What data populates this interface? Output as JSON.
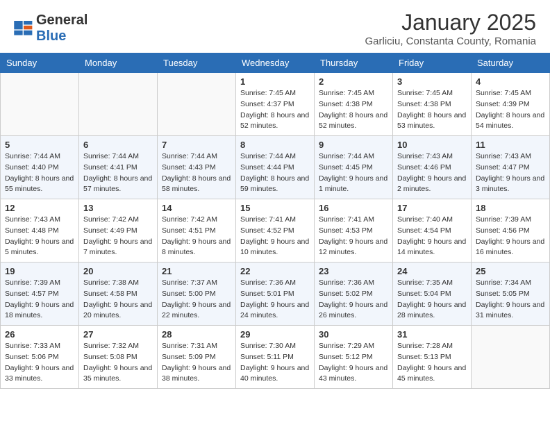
{
  "header": {
    "logo_general": "General",
    "logo_blue": "Blue",
    "month": "January 2025",
    "location": "Garliciu, Constanta County, Romania"
  },
  "days_of_week": [
    "Sunday",
    "Monday",
    "Tuesday",
    "Wednesday",
    "Thursday",
    "Friday",
    "Saturday"
  ],
  "weeks": [
    [
      {
        "day": "",
        "info": ""
      },
      {
        "day": "",
        "info": ""
      },
      {
        "day": "",
        "info": ""
      },
      {
        "day": "1",
        "info": "Sunrise: 7:45 AM\nSunset: 4:37 PM\nDaylight: 8 hours and 52 minutes."
      },
      {
        "day": "2",
        "info": "Sunrise: 7:45 AM\nSunset: 4:38 PM\nDaylight: 8 hours and 52 minutes."
      },
      {
        "day": "3",
        "info": "Sunrise: 7:45 AM\nSunset: 4:38 PM\nDaylight: 8 hours and 53 minutes."
      },
      {
        "day": "4",
        "info": "Sunrise: 7:45 AM\nSunset: 4:39 PM\nDaylight: 8 hours and 54 minutes."
      }
    ],
    [
      {
        "day": "5",
        "info": "Sunrise: 7:44 AM\nSunset: 4:40 PM\nDaylight: 8 hours and 55 minutes."
      },
      {
        "day": "6",
        "info": "Sunrise: 7:44 AM\nSunset: 4:41 PM\nDaylight: 8 hours and 57 minutes."
      },
      {
        "day": "7",
        "info": "Sunrise: 7:44 AM\nSunset: 4:43 PM\nDaylight: 8 hours and 58 minutes."
      },
      {
        "day": "8",
        "info": "Sunrise: 7:44 AM\nSunset: 4:44 PM\nDaylight: 8 hours and 59 minutes."
      },
      {
        "day": "9",
        "info": "Sunrise: 7:44 AM\nSunset: 4:45 PM\nDaylight: 9 hours and 1 minute."
      },
      {
        "day": "10",
        "info": "Sunrise: 7:43 AM\nSunset: 4:46 PM\nDaylight: 9 hours and 2 minutes."
      },
      {
        "day": "11",
        "info": "Sunrise: 7:43 AM\nSunset: 4:47 PM\nDaylight: 9 hours and 3 minutes."
      }
    ],
    [
      {
        "day": "12",
        "info": "Sunrise: 7:43 AM\nSunset: 4:48 PM\nDaylight: 9 hours and 5 minutes."
      },
      {
        "day": "13",
        "info": "Sunrise: 7:42 AM\nSunset: 4:49 PM\nDaylight: 9 hours and 7 minutes."
      },
      {
        "day": "14",
        "info": "Sunrise: 7:42 AM\nSunset: 4:51 PM\nDaylight: 9 hours and 8 minutes."
      },
      {
        "day": "15",
        "info": "Sunrise: 7:41 AM\nSunset: 4:52 PM\nDaylight: 9 hours and 10 minutes."
      },
      {
        "day": "16",
        "info": "Sunrise: 7:41 AM\nSunset: 4:53 PM\nDaylight: 9 hours and 12 minutes."
      },
      {
        "day": "17",
        "info": "Sunrise: 7:40 AM\nSunset: 4:54 PM\nDaylight: 9 hours and 14 minutes."
      },
      {
        "day": "18",
        "info": "Sunrise: 7:39 AM\nSunset: 4:56 PM\nDaylight: 9 hours and 16 minutes."
      }
    ],
    [
      {
        "day": "19",
        "info": "Sunrise: 7:39 AM\nSunset: 4:57 PM\nDaylight: 9 hours and 18 minutes."
      },
      {
        "day": "20",
        "info": "Sunrise: 7:38 AM\nSunset: 4:58 PM\nDaylight: 9 hours and 20 minutes."
      },
      {
        "day": "21",
        "info": "Sunrise: 7:37 AM\nSunset: 5:00 PM\nDaylight: 9 hours and 22 minutes."
      },
      {
        "day": "22",
        "info": "Sunrise: 7:36 AM\nSunset: 5:01 PM\nDaylight: 9 hours and 24 minutes."
      },
      {
        "day": "23",
        "info": "Sunrise: 7:36 AM\nSunset: 5:02 PM\nDaylight: 9 hours and 26 minutes."
      },
      {
        "day": "24",
        "info": "Sunrise: 7:35 AM\nSunset: 5:04 PM\nDaylight: 9 hours and 28 minutes."
      },
      {
        "day": "25",
        "info": "Sunrise: 7:34 AM\nSunset: 5:05 PM\nDaylight: 9 hours and 31 minutes."
      }
    ],
    [
      {
        "day": "26",
        "info": "Sunrise: 7:33 AM\nSunset: 5:06 PM\nDaylight: 9 hours and 33 minutes."
      },
      {
        "day": "27",
        "info": "Sunrise: 7:32 AM\nSunset: 5:08 PM\nDaylight: 9 hours and 35 minutes."
      },
      {
        "day": "28",
        "info": "Sunrise: 7:31 AM\nSunset: 5:09 PM\nDaylight: 9 hours and 38 minutes."
      },
      {
        "day": "29",
        "info": "Sunrise: 7:30 AM\nSunset: 5:11 PM\nDaylight: 9 hours and 40 minutes."
      },
      {
        "day": "30",
        "info": "Sunrise: 7:29 AM\nSunset: 5:12 PM\nDaylight: 9 hours and 43 minutes."
      },
      {
        "day": "31",
        "info": "Sunrise: 7:28 AM\nSunset: 5:13 PM\nDaylight: 9 hours and 45 minutes."
      },
      {
        "day": "",
        "info": ""
      }
    ]
  ]
}
